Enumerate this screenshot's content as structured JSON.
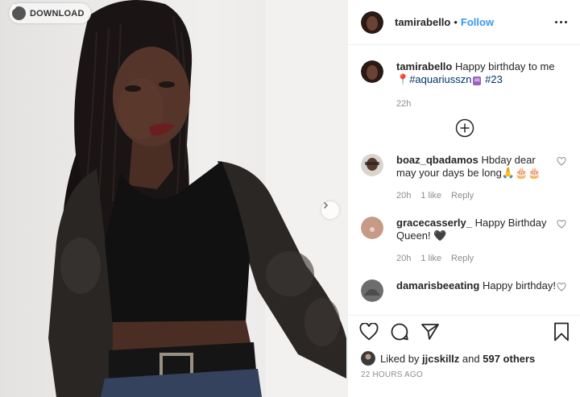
{
  "photo": {
    "download_label": "DOWNLOAD",
    "next_icon": "chevron-right-icon"
  },
  "header": {
    "username": "tamirabello",
    "separator": "•",
    "follow_label": "Follow",
    "more_icon": "more-options-icon"
  },
  "caption": {
    "username": "tamirabello",
    "text": "Happy birthday to me",
    "emoji_pin": "📍",
    "hashtag1": "#aquariusszn",
    "emoji_aquarius": "♒",
    "hashtag2": "#23",
    "time": "22h"
  },
  "load_more_icon": "plus-circle-icon",
  "comments": [
    {
      "username": "boaz_qbadamos",
      "text": "Hbday dear may your days be long🙏🎂🎂",
      "time": "20h",
      "likes": "1 like",
      "reply": "Reply"
    },
    {
      "username": "gracecasserly_",
      "text": "Happy Birthday Queen! 🖤",
      "time": "20h",
      "likes": "1 like",
      "reply": "Reply"
    },
    {
      "username": "damarisbeeating",
      "text": "Happy birthday!",
      "time": "",
      "likes": "",
      "reply": ""
    }
  ],
  "likes": {
    "prefix": "Liked by",
    "user": "jjcskillz",
    "and": "and",
    "others": "597 others"
  },
  "timestamp": "22 HOURS AGO",
  "colors": {
    "link": "#3897f0",
    "hashtag": "#003569",
    "muted": "#8e8e8e"
  }
}
